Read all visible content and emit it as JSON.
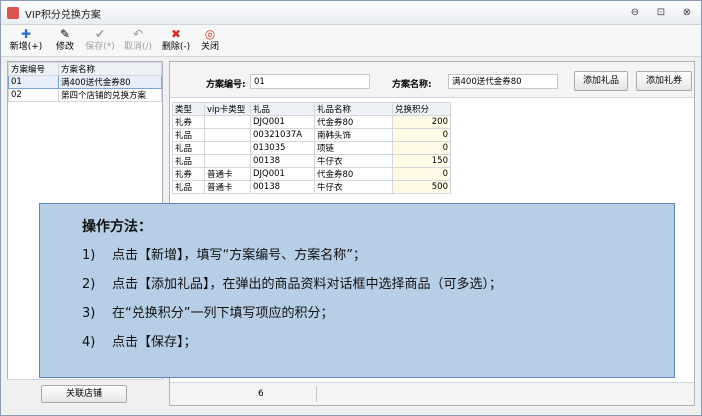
{
  "window": {
    "title": "VIP积分兑换方案",
    "minimize": "⊖",
    "restore": "⊡",
    "close": "⊗"
  },
  "toolbar": {
    "new": {
      "icon": "✚",
      "label": "新增(+)"
    },
    "edit": {
      "icon": "✎",
      "label": "修改"
    },
    "save": {
      "icon": "✔",
      "label": "保存(*)"
    },
    "cancel": {
      "icon": "↶",
      "label": "取消(/)"
    },
    "delete": {
      "icon": "✖",
      "label": "删除(-)"
    },
    "close": {
      "icon": "◎",
      "label": "关闭"
    }
  },
  "left": {
    "headers": [
      "方案编号",
      "方案名称"
    ],
    "rows": [
      [
        "01",
        "满400送代金券80"
      ],
      [
        "02",
        "第四个店铺的兑换方案"
      ]
    ],
    "button": "关联店铺"
  },
  "form": {
    "code_label": "方案编号:",
    "code_value": "01",
    "name_label": "方案名称:",
    "name_value": "满400送代金券80",
    "btn1": "添加礼品",
    "btn2": "添加礼券"
  },
  "grid": {
    "headers": [
      "类型",
      "vip卡类型",
      "礼品",
      "礼品名称",
      "兑换积分"
    ],
    "rows": [
      [
        "礼券",
        "",
        "DJQ001",
        "代金券80",
        "200"
      ],
      [
        "礼品",
        "",
        "00321037A",
        "南韩头饰",
        "0"
      ],
      [
        "礼品",
        "",
        "013035",
        "项链",
        "0"
      ],
      [
        "礼品",
        "",
        "00138",
        "牛仔衣",
        "150"
      ],
      [
        "礼券",
        "普通卡",
        "DJQ001",
        "代金券80",
        "0"
      ],
      [
        "礼品",
        "普通卡",
        "00138",
        "牛仔衣",
        "500"
      ]
    ]
  },
  "status": {
    "count": "6"
  },
  "overlay": {
    "heading": "操作方法：",
    "steps": [
      {
        "n": "1)",
        "text": "点击【新增】，填写“方案编号、方案名称”；"
      },
      {
        "n": "2)",
        "text": "点击【添加礼品】，在弹出的商品资料对话框中选择商品（可多选）；"
      },
      {
        "n": "3)",
        "text": "在“兑换积分”一列下填写项应的积分；"
      },
      {
        "n": "4)",
        "text": "点击【保存】；"
      }
    ]
  },
  "colors": {
    "accent": "#b6cee6",
    "overlay_border": "#5a87b8",
    "new_icon": "#2b6fc9",
    "delete_icon": "#d9302c"
  }
}
